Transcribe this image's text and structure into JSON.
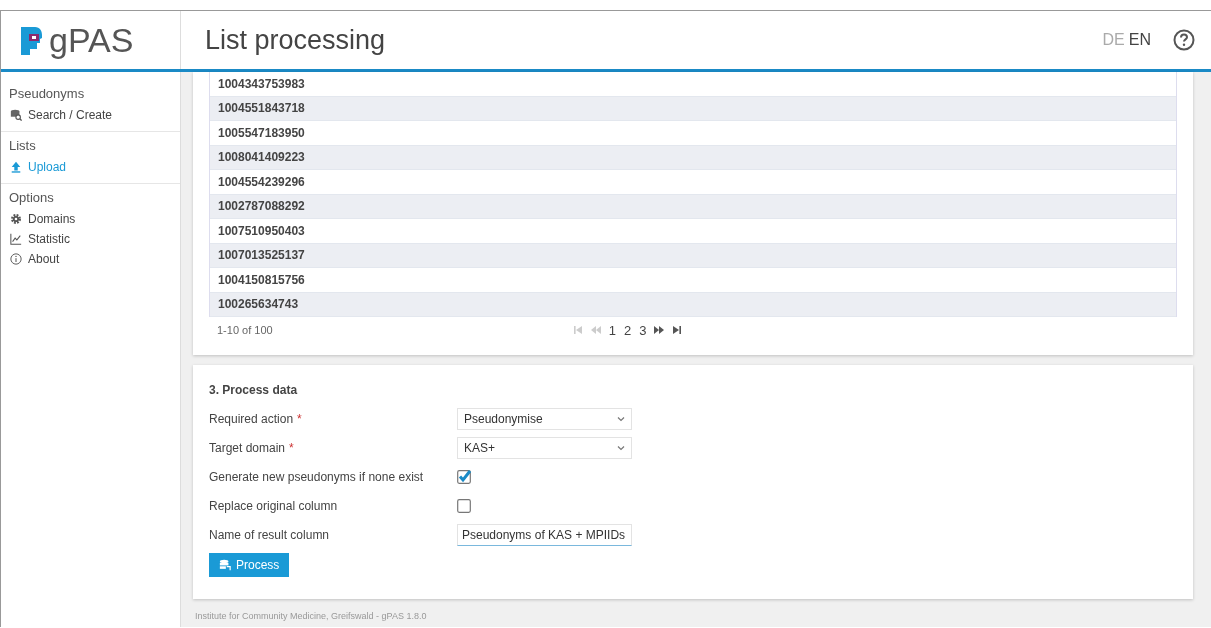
{
  "header": {
    "app_name": "gPAS",
    "title": "List processing",
    "languages": [
      {
        "label": "DE",
        "selected": false
      },
      {
        "label": "EN",
        "selected": true
      }
    ]
  },
  "sidebar": {
    "sections": [
      {
        "title": "Pseudonyms",
        "items": [
          {
            "label": "Search / Create",
            "selected": false
          }
        ]
      },
      {
        "title": "Lists",
        "items": [
          {
            "label": "Upload",
            "selected": true
          }
        ]
      },
      {
        "title": "Options",
        "items": [
          {
            "label": "Domains",
            "selected": false
          },
          {
            "label": "Statistic",
            "selected": false
          },
          {
            "label": "About",
            "selected": false
          }
        ]
      }
    ]
  },
  "table": {
    "rows": [
      "1004343753983",
      "1004551843718",
      "1005547183950",
      "1008041409223",
      "1004554239296",
      "1002787088292",
      "1007510950403",
      "1007013525137",
      "1004150815756",
      "100265634743"
    ],
    "range": "1-10 of 100",
    "pages": [
      "1",
      "2",
      "3"
    ]
  },
  "process": {
    "title": "3. Process data",
    "fields": [
      {
        "kind": "select",
        "label": "Required action",
        "required_mark": "*",
        "value": "Pseudonymise"
      },
      {
        "kind": "select",
        "label": "Target domain",
        "required_mark": "*",
        "value": "KAS+"
      },
      {
        "kind": "checkbox",
        "label": "Generate new pseudonyms if none exist",
        "checked": true
      },
      {
        "kind": "checkbox",
        "label": "Replace original column",
        "checked": false
      },
      {
        "kind": "text",
        "label": "Name of result column",
        "value": "Pseudonyms of KAS + MPIIDs"
      }
    ],
    "button": "Process"
  },
  "footer": "Institute for Community Medicine, Greifswald - gPAS 1.8.0"
}
